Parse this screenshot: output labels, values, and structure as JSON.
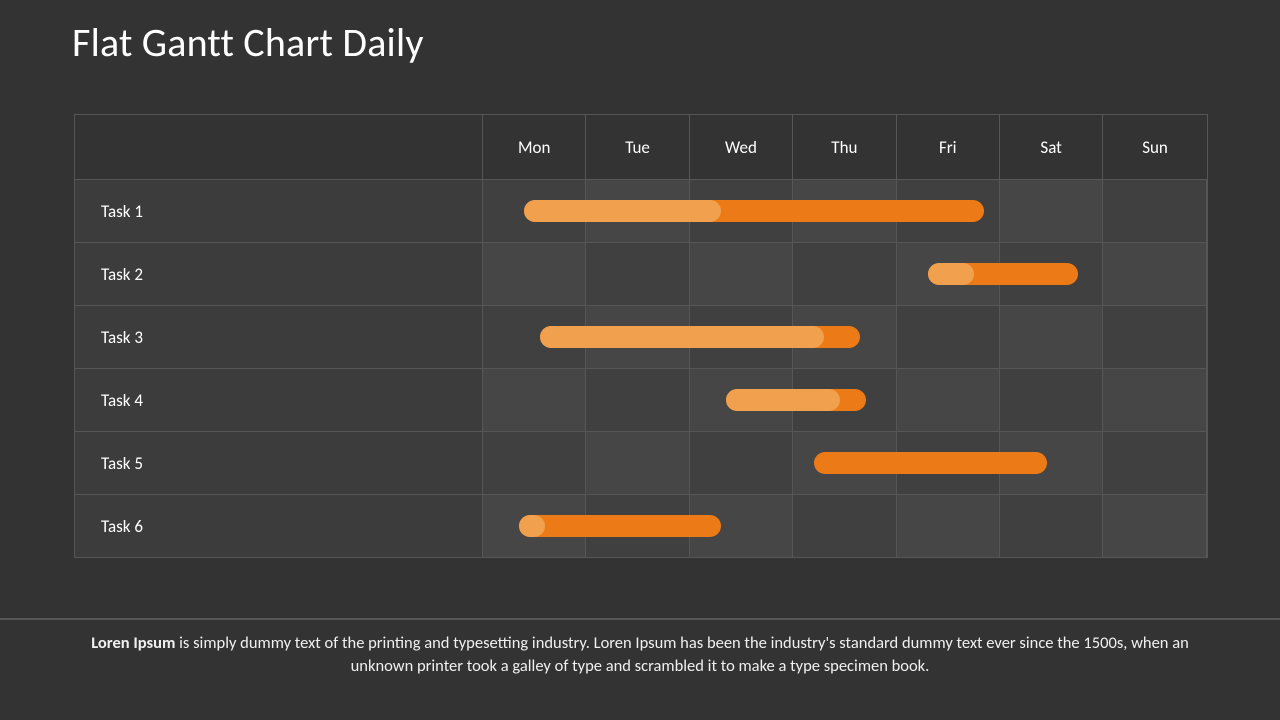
{
  "title": "Flat Gantt Chart Daily",
  "days": [
    "Mon",
    "Tue",
    "Wed",
    "Thu",
    "Fri",
    "Sat",
    "Sun"
  ],
  "tasks": [
    "Task 1",
    "Task 2",
    "Task 3",
    "Task 4",
    "Task 5",
    "Task 6"
  ],
  "footer_lead": "Loren Ipsum",
  "footer_rest": " is simply dummy text of the printing and typesetting industry. Loren Ipsum has been the industry's standard dummy text ever since the 1500s, when an unknown printer took a galley of type and scrambled it to make a type specimen book.",
  "colors": {
    "bar_bg": "#EC7B17",
    "bar_fg": "#F1A04E"
  },
  "chart_data": {
    "type": "gantt",
    "x_categories": [
      "Mon",
      "Tue",
      "Wed",
      "Thu",
      "Fri",
      "Sat",
      "Sun"
    ],
    "tasks": [
      {
        "name": "Task 1",
        "start": 0.4,
        "end": 4.85,
        "progress_end": 2.3
      },
      {
        "name": "Task 2",
        "start": 4.3,
        "end": 5.75,
        "progress_end": 4.75
      },
      {
        "name": "Task 3",
        "start": 0.55,
        "end": 3.65,
        "progress_end": 3.3
      },
      {
        "name": "Task 4",
        "start": 2.35,
        "end": 3.7,
        "progress_end": 3.45
      },
      {
        "name": "Task 5",
        "start": 3.2,
        "end": 5.45,
        "progress_end": 3.2
      },
      {
        "name": "Task 6",
        "start": 0.35,
        "end": 2.3,
        "progress_end": 0.6
      }
    ]
  }
}
